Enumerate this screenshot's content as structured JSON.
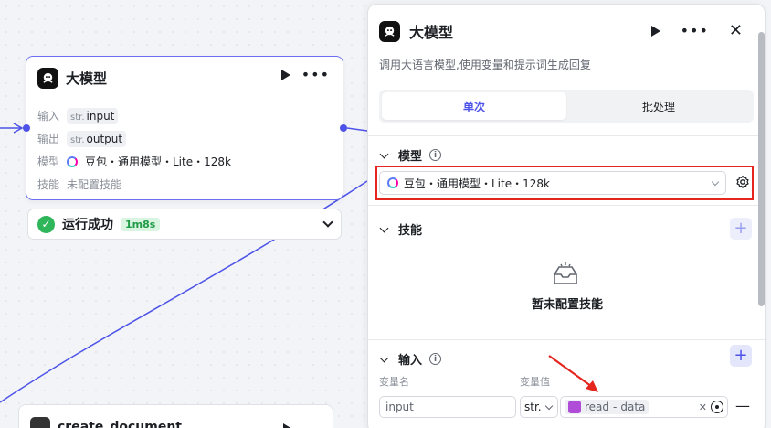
{
  "node": {
    "title": "大模型",
    "rows": [
      {
        "label": "输入",
        "type": "str.",
        "value": "input"
      },
      {
        "label": "输出",
        "type": "str.",
        "value": "output"
      }
    ],
    "model_label": "模型",
    "model_value": "豆包・通用模型・Lite・128k",
    "skill_label": "技能",
    "skill_value": "未配置技能"
  },
  "run_status": {
    "text": "运行成功",
    "duration": "1m8s"
  },
  "node2": {
    "title": "create_document"
  },
  "panel": {
    "title": "大模型",
    "description": "调用大语言模型,使用变量和提示词生成回复",
    "tabs": [
      {
        "label": "单次",
        "active": true
      },
      {
        "label": "批处理",
        "active": false
      }
    ],
    "model_section": {
      "title": "模型",
      "selected": "豆包・通用模型・Lite・128k"
    },
    "skills_section": {
      "title": "技能",
      "empty_text": "暂未配置技能"
    },
    "input_section": {
      "title": "输入",
      "col_name": "变量名",
      "col_value": "变量值",
      "row": {
        "name": "input",
        "type": "str.",
        "ref_node": "read",
        "ref_sep": "-",
        "ref_field": "data"
      }
    }
  },
  "colors": {
    "accent": "#4d53e8",
    "success": "#2fb55a",
    "highlight": "#e5261f"
  }
}
